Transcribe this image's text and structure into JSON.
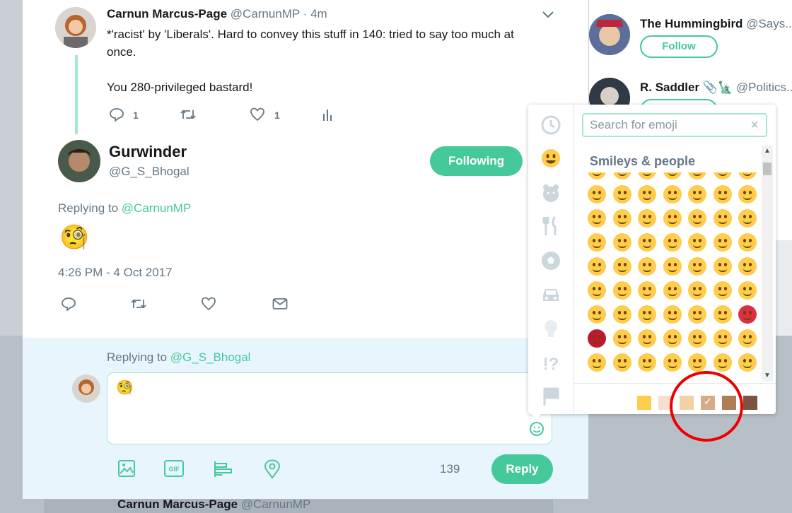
{
  "sidebar": {
    "who_to_follow": [
      {
        "name": "The Hummingbird",
        "handle": "@Says...",
        "button": "Follow"
      },
      {
        "name": "R. Saddler",
        "handle": "@Politics...",
        "button": "Follow"
      }
    ]
  },
  "parent_tweet": {
    "name": "Carnun Marcus-Page",
    "handle": "@CarnunMP · 4m",
    "line1": "*'racist' by 'Liberals'. Hard to convey this stuff in 140: tried to say too much at",
    "line2": "once.",
    "line3": "You 280-privileged bastard!",
    "reply_count": "1",
    "like_count": "1"
  },
  "focus_tweet": {
    "name": "Gurwinder",
    "handle": "@G_S_Bhogal",
    "follow_button": "Following",
    "replying_prefix": "Replying to",
    "replying_mention": "@CarnunMP",
    "emoji": "🧐",
    "timestamp": "4:26 PM - 4 Oct 2017"
  },
  "composer": {
    "replying_prefix": "Replying to",
    "replying_mention": "@G_S_Bhogal",
    "text": "🧐",
    "char_count": "139",
    "reply_button": "Reply"
  },
  "next_tweet": {
    "name": "Carnun Marcus-Page",
    "handle": "@CarnunMP"
  },
  "emoji_picker": {
    "search_placeholder": "Search for emoji",
    "section_title": "Smileys & people",
    "categories": [
      "clock-icon",
      "smiley-icon",
      "animal-icon",
      "food-icon",
      "ball-icon",
      "car-icon",
      "bulb-icon",
      "symbols-icon",
      "flag-icon"
    ],
    "skin_tones": [
      "#ffcc4d",
      "#f7dece",
      "#f3d2a2",
      "#d5ab88",
      "#af7e57",
      "#7c533e"
    ],
    "selected_tone": 3
  },
  "colors": {
    "accent": "#45c99a",
    "annotation": "#e00000"
  }
}
